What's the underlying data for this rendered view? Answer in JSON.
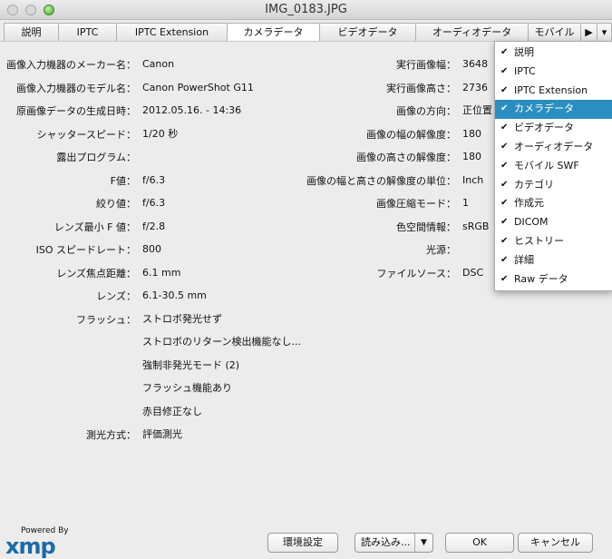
{
  "window": {
    "title": "IMG_0183.JPG"
  },
  "tabs": [
    "説明",
    "IPTC",
    "IPTC Extension",
    "カメラデータ",
    "ビデオデータ",
    "オーディオデータ",
    "モバイル"
  ],
  "selected_tab": "カメラデータ",
  "left_fields": [
    {
      "label": "画像入力機器のメーカー名：",
      "value": "Canon"
    },
    {
      "label": "画像入力機器のモデル名：",
      "value": "Canon PowerShot G11"
    },
    {
      "label": "原画像データの生成日時：",
      "value": "2012.05.16. - 14:36"
    },
    {
      "label": "シャッタースピード：",
      "value": "1/20 秒"
    },
    {
      "label": "露出プログラム：",
      "value": ""
    },
    {
      "label": "F値：",
      "value": "f/6.3"
    },
    {
      "label": "絞り値：",
      "value": "f/6.3"
    },
    {
      "label": "レンズ最小 F 値：",
      "value": "f/2.8"
    },
    {
      "label": "ISO スピードレート：",
      "value": "800"
    },
    {
      "label": "レンズ焦点距離：",
      "value": "6.1 mm"
    },
    {
      "label": "レンズ：",
      "value": "6.1-30.5 mm"
    },
    {
      "label": "フラッシュ：",
      "value": "ストロボ発光せず"
    }
  ],
  "flash_extra": [
    "ストロボのリターン検出機能なし...",
    "強制非発光モード (2)",
    "フラッシュ機能あり",
    "赤目修正なし"
  ],
  "metering": {
    "label": "測光方式：",
    "value": "評価測光"
  },
  "right_fields": [
    {
      "label": "実行画像幅：",
      "value": "3648"
    },
    {
      "label": "実行画像高さ：",
      "value": "2736"
    },
    {
      "label": "画像の方向：",
      "value": "正位置"
    },
    {
      "label": "画像の幅の解像度：",
      "value": "180"
    },
    {
      "label": "画像の高さの解像度：",
      "value": "180"
    },
    {
      "label": "画像の幅と高さの解像度の単位：",
      "value": "Inch"
    },
    {
      "label": "画像圧縮モード：",
      "value": "1"
    },
    {
      "label": "色空間情報：",
      "value": "sRGB"
    },
    {
      "label": "光源：",
      "value": ""
    },
    {
      "label": "ファイルソース：",
      "value": "DSC"
    }
  ],
  "menu": {
    "items": [
      "説明",
      "IPTC",
      "IPTC Extension",
      "カメラデータ",
      "ビデオデータ",
      "オーディオデータ",
      "モバイル SWF",
      "カテゴリ",
      "作成元",
      "DICOM",
      "ヒストリー",
      "詳細",
      "Raw データ"
    ],
    "highlighted": 3
  },
  "footer": {
    "logo_top": "Powered By",
    "logo": "xmp",
    "prefs": "環境設定",
    "import": "読み込み...",
    "ok": "OK",
    "cancel": "キャンセル"
  },
  "colors": {
    "highlight": "#2a8fc0"
  }
}
